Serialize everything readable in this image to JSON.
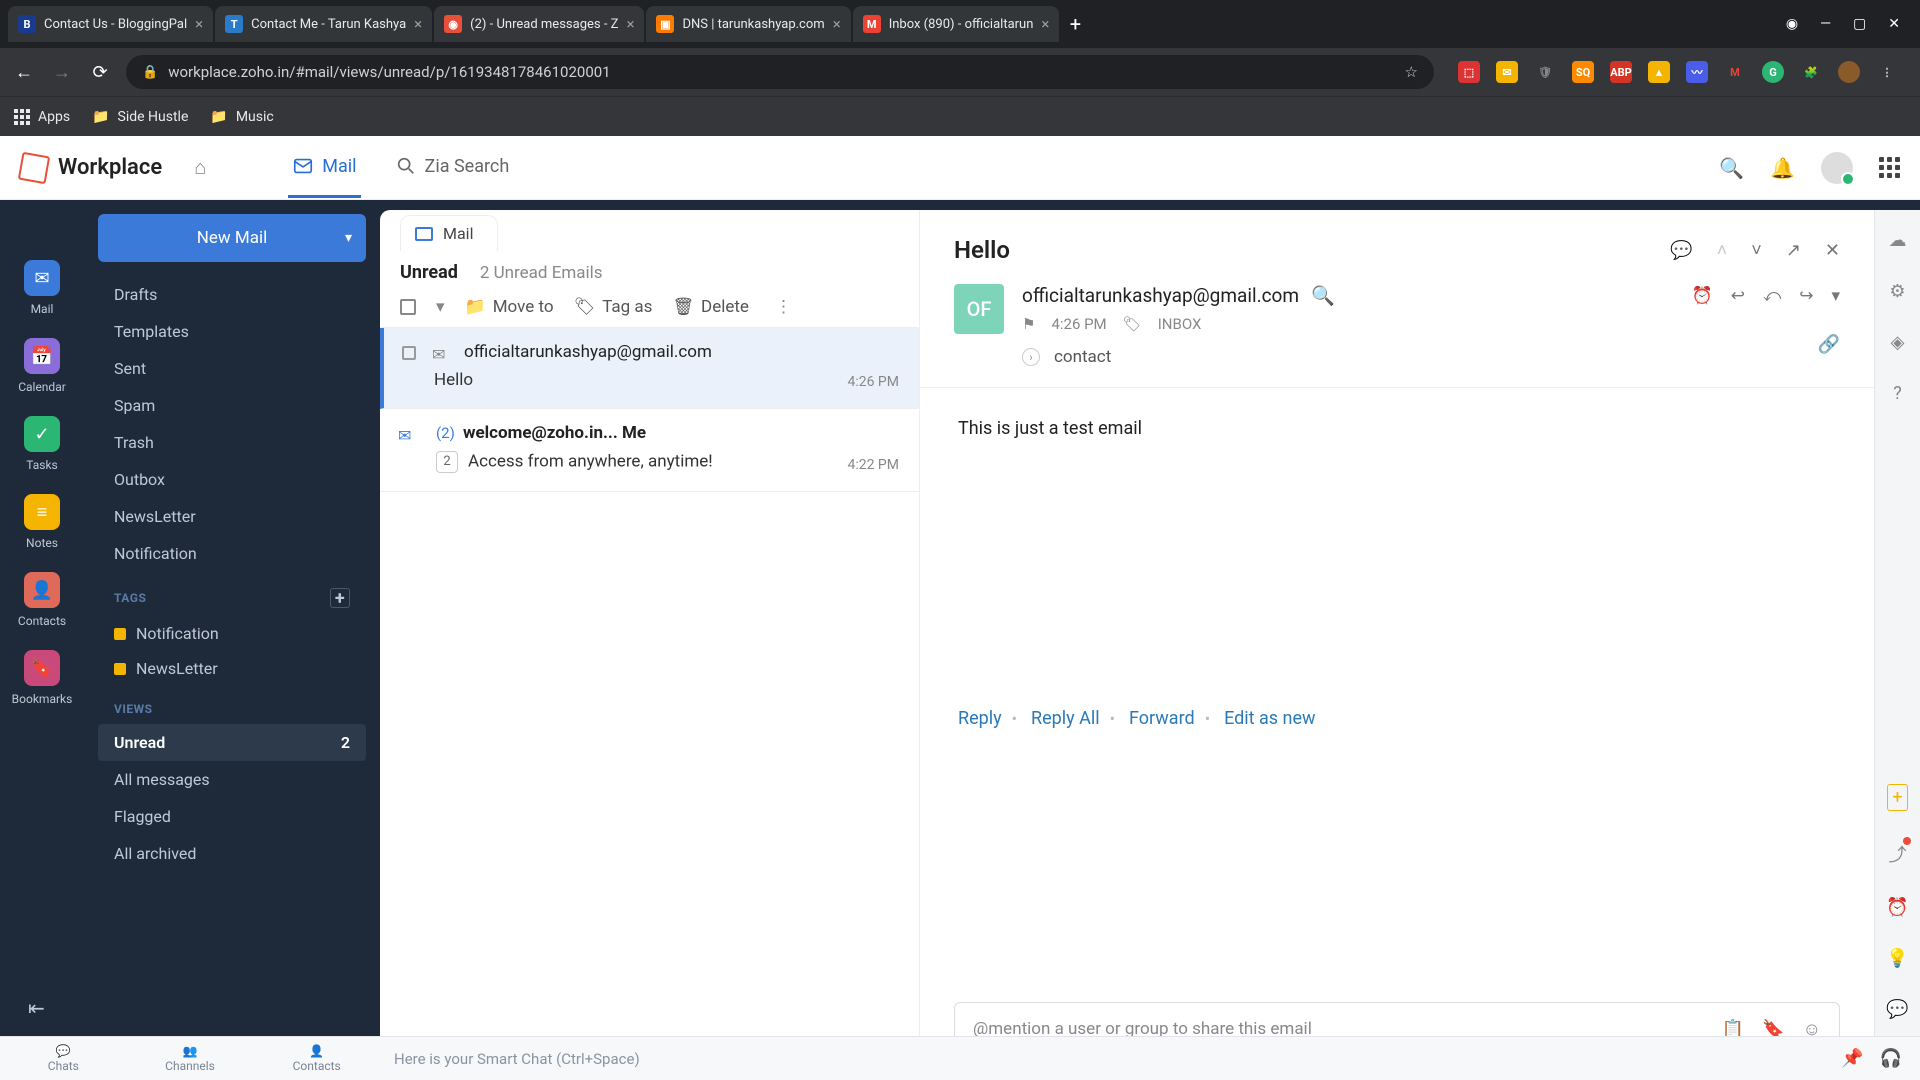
{
  "browser": {
    "tabs": [
      {
        "label": "Contact Us - BloggingPal",
        "favicon_bg": "#1a3a8f",
        "favicon_txt": "B"
      },
      {
        "label": "Contact Me - Tarun Kashya",
        "favicon_bg": "#2a7cc9",
        "favicon_txt": "T"
      },
      {
        "label": "(2) - Unread messages - Z",
        "favicon_bg": "#e8503a",
        "favicon_txt": "◉",
        "active": true
      },
      {
        "label": "DNS | tarunkashyap.com",
        "favicon_bg": "#ff7a00",
        "favicon_txt": "▣"
      },
      {
        "label": "Inbox (890) - officialtarun",
        "favicon_bg": "#ea4335",
        "favicon_txt": "M"
      }
    ],
    "url": "workplace.zoho.in/#mail/views/unread/p/1619348178461020001",
    "bookmarks": [
      {
        "label": "Apps",
        "type": "grid"
      },
      {
        "label": "Side Hustle",
        "type": "folder"
      },
      {
        "label": "Music",
        "type": "folder"
      }
    ]
  },
  "header": {
    "brand": "Workplace",
    "nav": [
      {
        "label": "Mail",
        "active": true
      },
      {
        "label": "Zia Search",
        "active": false
      }
    ]
  },
  "rail": [
    {
      "label": "Mail",
      "color": "#3b7ad9"
    },
    {
      "label": "Calendar",
      "color": "#8a6dd9"
    },
    {
      "label": "Tasks",
      "color": "#2bb673"
    },
    {
      "label": "Notes",
      "color": "#f4b400"
    },
    {
      "label": "Contacts",
      "color": "#e06a5a"
    },
    {
      "label": "Bookmarks",
      "color": "#c94a7a"
    }
  ],
  "sidebar": {
    "newmail": "New Mail",
    "folders": [
      "Drafts",
      "Templates",
      "Sent",
      "Spam",
      "Trash",
      "Outbox",
      "NewsLetter",
      "Notification"
    ],
    "tags_header": "TAGS",
    "tags": [
      "Notification",
      "NewsLetter"
    ],
    "views_header": "VIEWS",
    "views": [
      {
        "label": "Unread",
        "count": "2",
        "active": true
      },
      {
        "label": "All messages"
      },
      {
        "label": "Flagged"
      },
      {
        "label": "All archived"
      }
    ]
  },
  "list": {
    "tab": "Mail",
    "title": "Unread",
    "subtitle": "2 Unread Emails",
    "toolbar": {
      "move": "Move to",
      "tag": "Tag as",
      "delete": "Delete"
    },
    "messages": [
      {
        "from": "officialtarunkashyap@gmail.com",
        "subject": "Hello",
        "time": "4:26 PM",
        "selected": true
      },
      {
        "from_prefix": "(2)",
        "from": "welcome@zoho.in... Me",
        "subject": "Access from anywhere, anytime!",
        "time": "4:22 PM",
        "badge": "2"
      }
    ]
  },
  "reader": {
    "subject": "Hello",
    "avatar": "OF",
    "from": "officialtarunkashyap@gmail.com",
    "time": "4:26 PM",
    "folder": "INBOX",
    "label1": "contact",
    "body": "This is just a test email",
    "actions": {
      "reply": "Reply",
      "replyall": "Reply All",
      "forward": "Forward",
      "editnew": "Edit as new"
    },
    "mention_placeholder": "@mention a user or group to share this email"
  },
  "chatbar": {
    "tabs": [
      "Chats",
      "Channels",
      "Contacts"
    ],
    "placeholder": "Here is your Smart Chat (Ctrl+Space)"
  }
}
